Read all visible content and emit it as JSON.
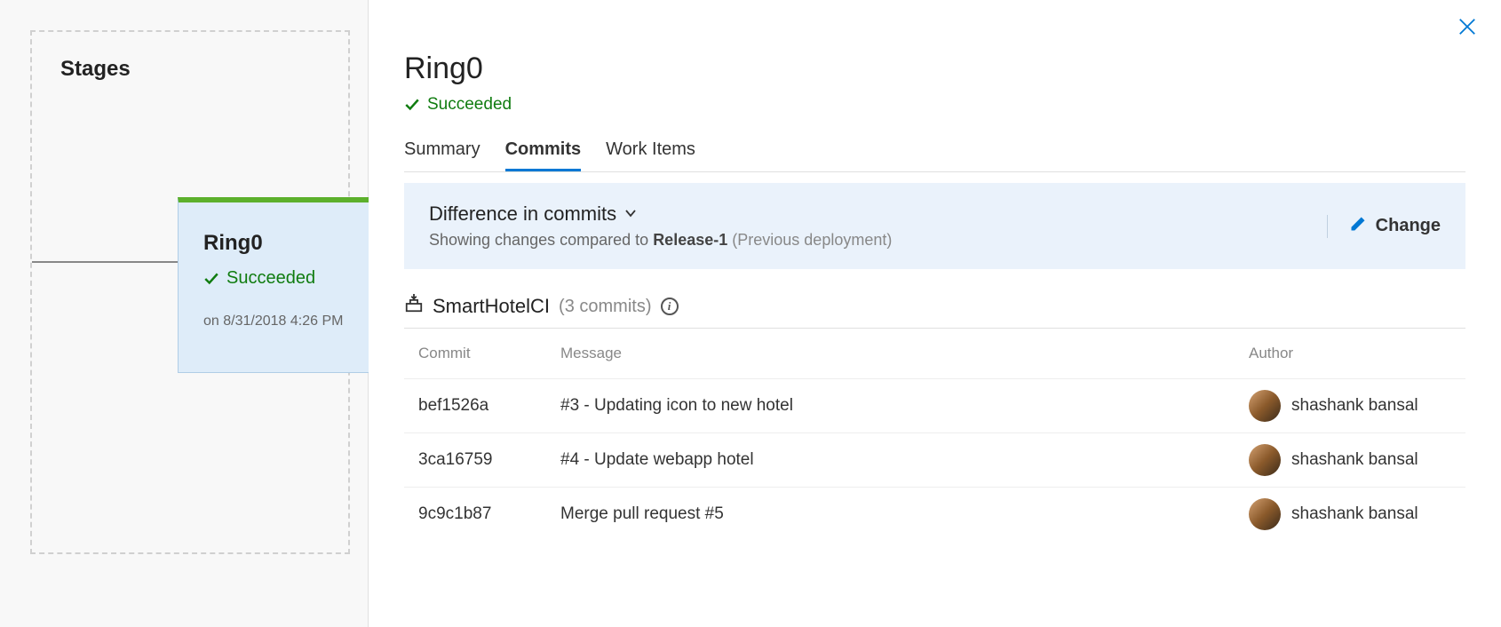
{
  "leftPanel": {
    "title": "Stages",
    "stageCard": {
      "title": "Ring0",
      "status": "Succeeded",
      "date": "on 8/31/2018 4:26 PM"
    }
  },
  "rightPanel": {
    "title": "Ring0",
    "status": "Succeeded",
    "tabs": [
      {
        "label": "Summary",
        "active": false
      },
      {
        "label": "Commits",
        "active": true
      },
      {
        "label": "Work Items",
        "active": false
      }
    ],
    "diffBar": {
      "title": "Difference in commits",
      "descPrefix": "Showing changes compared to",
      "releaseName": "Release-1",
      "prevNote": "(Previous deployment)",
      "changeLabel": "Change"
    },
    "pipeline": {
      "name": "SmartHotelCI",
      "commitCount": "(3 commits)"
    },
    "tableHeaders": {
      "commit": "Commit",
      "message": "Message",
      "author": "Author"
    },
    "commits": [
      {
        "hash": "bef1526a",
        "message": "#3 - Updating icon to new hotel",
        "author": "shashank bansal"
      },
      {
        "hash": "3ca16759",
        "message": "#4 - Update webapp hotel",
        "author": "shashank bansal"
      },
      {
        "hash": "9c9c1b87",
        "message": "Merge pull request #5",
        "author": "shashank bansal"
      }
    ]
  }
}
